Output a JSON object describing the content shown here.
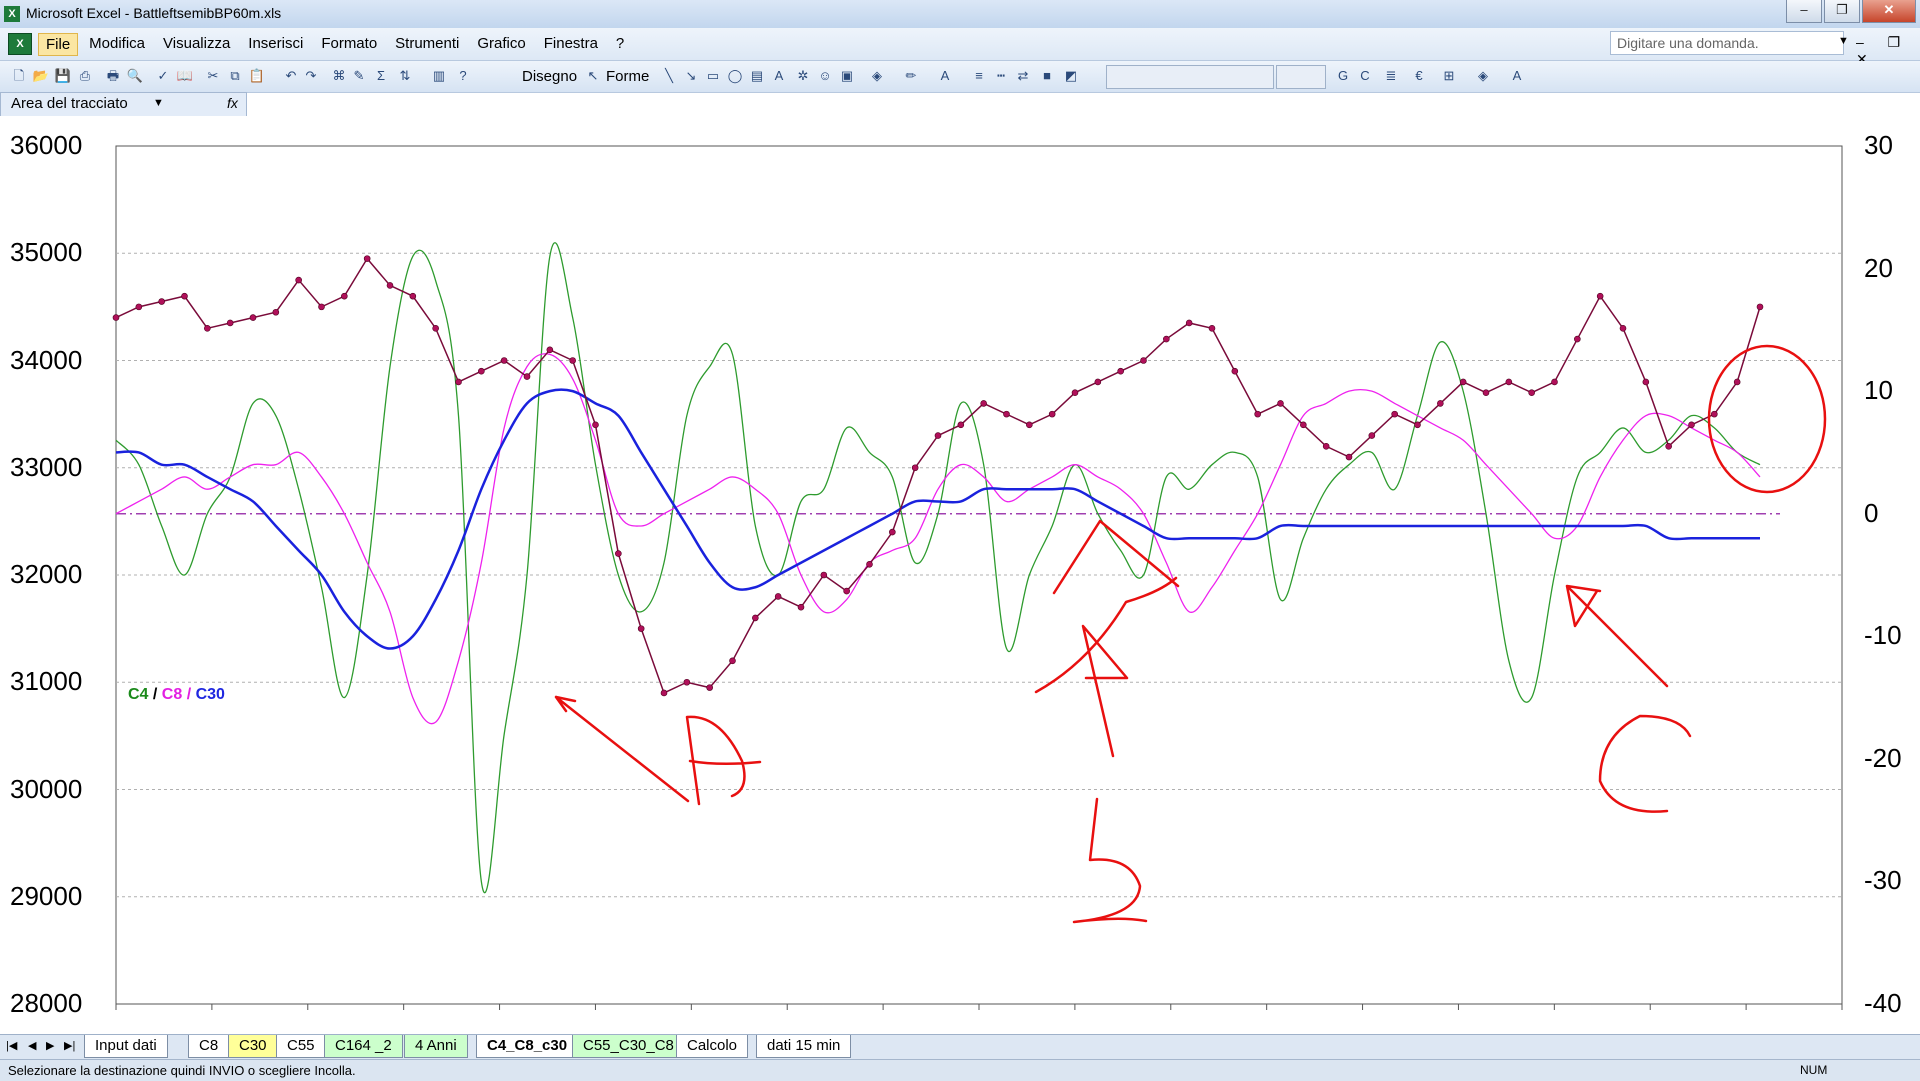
{
  "window": {
    "title": "Microsoft Excel - BattleftsemibBP60m.xls",
    "minimize": "–",
    "restore": "❐",
    "close": "✕"
  },
  "menu": {
    "items": [
      "File",
      "Modifica",
      "Visualizza",
      "Inserisci",
      "Formato",
      "Strumenti",
      "Grafico",
      "Finestra",
      "?"
    ],
    "help_placeholder": "Digitare una domanda."
  },
  "toolbar": {
    "drawing_label": "Disegno",
    "shapes_label": "Forme"
  },
  "namebox": {
    "value": "Area del tracciato",
    "fx": "fx"
  },
  "sheets": {
    "tabs": [
      {
        "label": "Input dati",
        "color": "#ffffff"
      },
      {
        "label": "C8",
        "color": "#ffffff"
      },
      {
        "label": "C30",
        "color": "#ffff99"
      },
      {
        "label": "C55",
        "color": "#ffffff"
      },
      {
        "label": "C164 _2",
        "color": "#ccffcc"
      },
      {
        "label": "4 Anni",
        "color": "#ccffcc"
      },
      {
        "label": "C4_C8_c30",
        "color": "#ffffff",
        "active": true
      },
      {
        "label": "C55_C30_C8",
        "color": "#ccffcc"
      },
      {
        "label": "Calcolo",
        "color": "#ffffff"
      },
      {
        "label": "dati 15 min",
        "color": "#ffffff"
      }
    ]
  },
  "status": {
    "message": "Selezionare la destinazione quindi INVIO o scegliere Incolla.",
    "num": "NUM"
  },
  "annotations": {
    "letters": [
      "A",
      "B",
      "C"
    ]
  },
  "chart_data": {
    "type": "line",
    "title": "",
    "legend": {
      "entries": [
        {
          "name": "C4",
          "color": "#1b8a1b"
        },
        {
          "name": "C8",
          "color": "#e21fe2"
        },
        {
          "name": "C30",
          "color": "#1f27e0"
        }
      ],
      "text": "C4 / C8/ C30",
      "placement": "left-middle"
    },
    "y_left": {
      "range": [
        28000,
        36000
      ],
      "ticks": [
        "36000",
        "35000",
        "34000",
        "33000",
        "32000",
        "31000",
        "30000",
        "29000",
        "28000"
      ]
    },
    "y_right": {
      "range": [
        -40,
        30
      ],
      "ticks": [
        "30",
        "20",
        "10",
        "0",
        "-10",
        "-20",
        "-30",
        "-40"
      ]
    },
    "grid": "horizontal-dashed",
    "x_points": 73,
    "price": {
      "name": "price",
      "axis": "left",
      "color": "#cc1155",
      "values": [
        34400,
        34500,
        34550,
        34600,
        34300,
        34350,
        34400,
        34450,
        34750,
        34500,
        34600,
        34950,
        34700,
        34600,
        34300,
        33800,
        33900,
        34000,
        33850,
        34100,
        34000,
        33400,
        32200,
        31500,
        30900,
        31000,
        30950,
        31200,
        31600,
        31800,
        31700,
        32000,
        31850,
        32100,
        32400,
        33000,
        33300,
        33400,
        33600,
        33500,
        33400,
        33500,
        33700,
        33800,
        33900,
        34000,
        34200,
        34350,
        34300,
        33900,
        33500,
        33600,
        33400,
        33200,
        33100,
        33300,
        33500,
        33400,
        33600,
        33800,
        33700,
        33800,
        33700,
        33800,
        34200,
        34600,
        34300,
        33800,
        33200,
        33400,
        33500,
        33800,
        34500
      ]
    },
    "series": [
      {
        "name": "C4",
        "axis": "right",
        "color": "#2e9b2e",
        "values": [
          6,
          4,
          -1,
          -5,
          0,
          3,
          9,
          8,
          2,
          -6,
          -15,
          -5,
          12,
          21,
          19,
          8,
          -30,
          -18,
          -5,
          21,
          16,
          4,
          -5,
          -8,
          -4,
          8,
          12,
          13,
          -1,
          -5,
          1,
          2,
          7,
          5,
          3,
          -4,
          0,
          9,
          4,
          -11,
          -5,
          -1,
          4,
          0,
          -3,
          -5,
          3,
          2,
          4,
          5,
          3,
          -7,
          -2,
          2,
          4,
          5,
          2,
          8,
          14,
          10,
          0,
          -12,
          -15,
          -5,
          3,
          5,
          7,
          5,
          6,
          8,
          7,
          5,
          4
        ]
      },
      {
        "name": "C8",
        "axis": "right",
        "color": "#ee22ee",
        "values": [
          0,
          1,
          2,
          3,
          2,
          3,
          4,
          4,
          5,
          3,
          0,
          -4,
          -8,
          -15,
          -17,
          -12,
          -4,
          7,
          12,
          13,
          11,
          6,
          0,
          -1,
          0,
          1,
          2,
          3,
          2,
          0,
          -5,
          -8,
          -7,
          -4,
          -3,
          -2,
          2,
          4,
          3,
          1,
          2,
          3,
          4,
          3,
          2,
          0,
          -4,
          -8,
          -6,
          -3,
          0,
          4,
          8,
          9,
          10,
          10,
          9,
          8,
          7,
          6,
          4,
          2,
          0,
          -2,
          -1,
          3,
          6,
          8,
          8,
          7,
          6,
          5,
          3
        ]
      },
      {
        "name": "C30",
        "axis": "right",
        "color": "#1a22dd",
        "values": [
          5,
          5,
          4,
          4,
          3,
          2,
          1,
          -1,
          -3,
          -5,
          -8,
          -10,
          -11,
          -10,
          -7,
          -3,
          2,
          6,
          9,
          10,
          10,
          9,
          8,
          5,
          2,
          -1,
          -4,
          -6,
          -6,
          -5,
          -4,
          -3,
          -2,
          -1,
          0,
          1,
          1,
          1,
          2,
          2,
          2,
          2,
          2,
          1,
          0,
          -1,
          -2,
          -2,
          -2,
          -2,
          -2,
          -1,
          -1,
          -1,
          -1,
          -1,
          -1,
          -1,
          -1,
          -1,
          -1,
          -1,
          -1,
          -1,
          -1,
          -1,
          -1,
          -1,
          -2,
          -2,
          -2,
          -2,
          -2
        ]
      }
    ],
    "reference_line": {
      "value": 0,
      "axis": "right",
      "color": "#a040b0",
      "style": "dash-dot"
    }
  }
}
